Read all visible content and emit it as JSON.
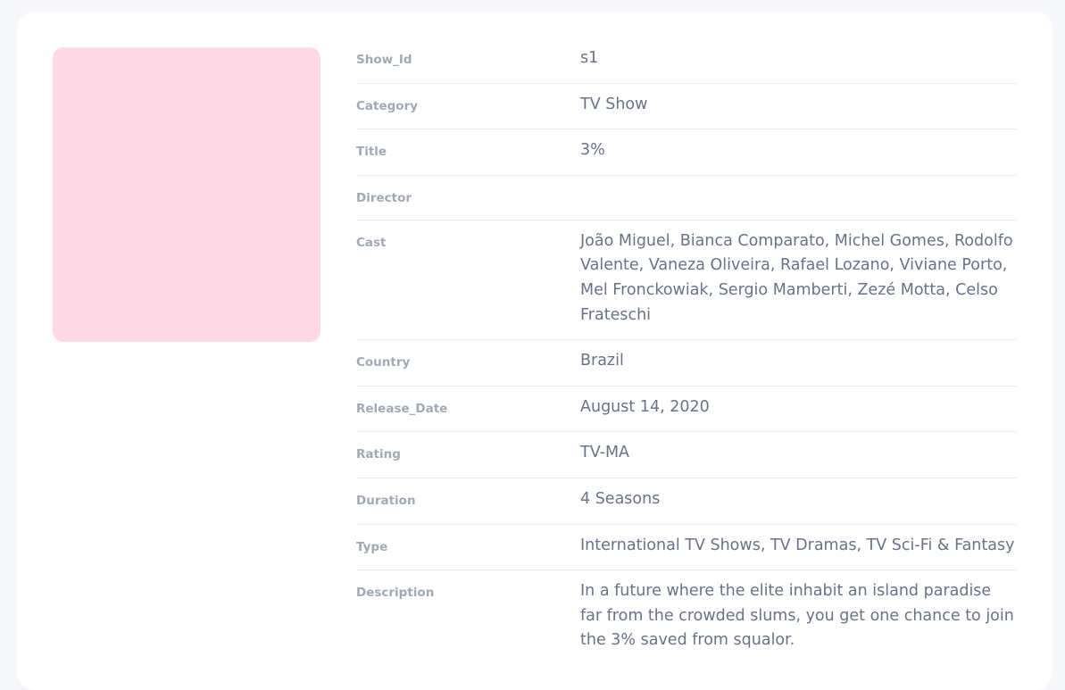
{
  "poster": {
    "color": "#ffd9e5"
  },
  "fields": [
    {
      "label": "Show_Id",
      "value": "s1"
    },
    {
      "label": "Category",
      "value": "TV Show"
    },
    {
      "label": "Title",
      "value": "3%"
    },
    {
      "label": "Director",
      "value": ""
    },
    {
      "label": "Cast",
      "value": "João Miguel, Bianca Comparato, Michel Gomes, Rodolfo Valente, Vaneza Oliveira, Rafael Lozano, Viviane Porto, Mel Fronckowiak, Sergio Mamberti, Zezé Motta, Celso Frateschi"
    },
    {
      "label": "Country",
      "value": "Brazil"
    },
    {
      "label": "Release_Date",
      "value": "August 14, 2020"
    },
    {
      "label": "Rating",
      "value": "TV-MA"
    },
    {
      "label": "Duration",
      "value": "4 Seasons"
    },
    {
      "label": "Type",
      "value": "International TV Shows, TV Dramas, TV Sci-Fi & Fantasy"
    },
    {
      "label": "Description",
      "value": "In a future where the elite inhabit an island paradise far from the crowded slums, you get one chance to join the 3% saved from squalor."
    }
  ]
}
